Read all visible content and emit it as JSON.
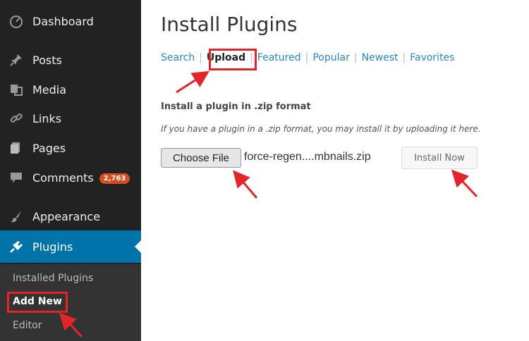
{
  "sidebar": {
    "items": [
      {
        "label": "Dashboard",
        "icon": "dashboard-icon"
      },
      {
        "label": "Posts",
        "icon": "pin-icon"
      },
      {
        "label": "Media",
        "icon": "media-icon"
      },
      {
        "label": "Links",
        "icon": "link-icon"
      },
      {
        "label": "Pages",
        "icon": "pages-icon"
      },
      {
        "label": "Comments",
        "icon": "comment-icon",
        "badge": "2,763"
      },
      {
        "label": "Appearance",
        "icon": "brush-icon"
      },
      {
        "label": "Plugins",
        "icon": "plug-icon"
      }
    ],
    "submenu": [
      "Installed Plugins",
      "Add New",
      "Editor"
    ]
  },
  "main": {
    "title": "Install Plugins",
    "tabs": [
      "Search",
      "Upload",
      "Featured",
      "Popular",
      "Newest",
      "Favorites"
    ],
    "current_tab": "Upload",
    "section_title": "Install a plugin in .zip format",
    "description": "If you have a plugin in a .zip format, you may install it by uploading it here.",
    "choose_file_label": "Choose File",
    "file_name": "force-regen....mbnails.zip",
    "install_label": "Install Now"
  },
  "colors": {
    "sidebar_bg": "#222222",
    "active_bg": "#0073aa",
    "link": "#2a86c8",
    "highlight": "#e4242b",
    "badge": "#d54e21"
  }
}
